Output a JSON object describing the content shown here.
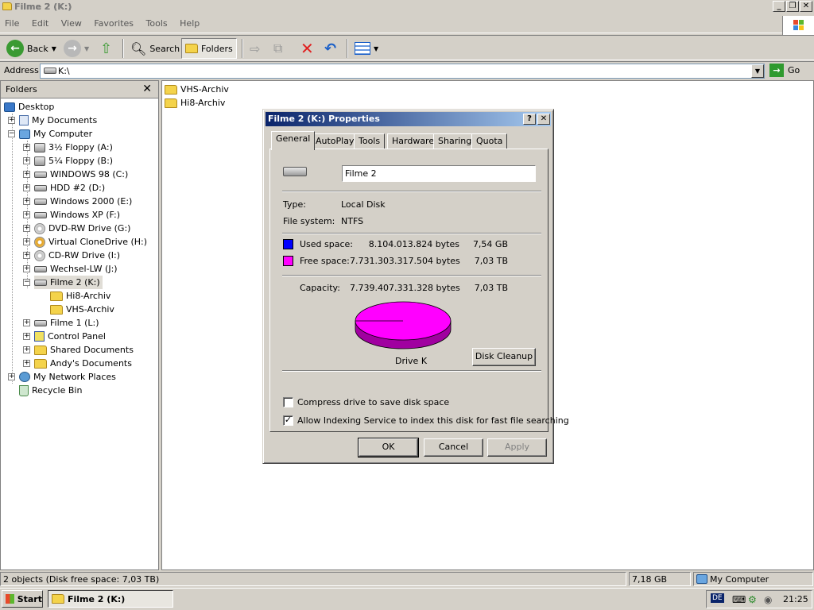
{
  "window": {
    "title": "Filme 2 (K:)"
  },
  "menu": [
    "File",
    "Edit",
    "View",
    "Favorites",
    "Tools",
    "Help"
  ],
  "toolbar": {
    "back": "Back",
    "search": "Search",
    "folders": "Folders"
  },
  "address": {
    "label": "Address",
    "value": "K:\\",
    "go": "Go"
  },
  "folders_pane": {
    "title": "Folders",
    "items": [
      "Desktop",
      "My Documents",
      "My Computer",
      "3½ Floppy (A:)",
      "5¼ Floppy (B:)",
      "WINDOWS 98 (C:)",
      "HDD #2 (D:)",
      "Windows 2000 (E:)",
      "Windows XP (F:)",
      "DVD-RW Drive (G:)",
      "Virtual CloneDrive (H:)",
      "CD-RW Drive (I:)",
      "Wechsel-LW (J:)",
      "Filme 2 (K:)",
      "Hi8-Archiv",
      "VHS-Archiv",
      "Filme 1 (L:)",
      "Control Panel",
      "Shared Documents",
      "Andy's Documents",
      "My Network Places",
      "Recycle Bin"
    ]
  },
  "files": [
    "VHS-Archiv",
    "Hi8-Archiv"
  ],
  "dialog": {
    "title": "Filme 2 (K:) Properties",
    "tabs": [
      "General",
      "AutoPlay",
      "Tools",
      "Hardware",
      "Sharing",
      "Quota"
    ],
    "name": "Filme 2",
    "type_label": "Type:",
    "type_value": "Local Disk",
    "fs_label": "File system:",
    "fs_value": "NTFS",
    "used_label": "Used space:",
    "used_bytes": "8.104.013.824 bytes",
    "used_size": "7,54 GB",
    "free_label": "Free space:",
    "free_bytes": "7.731.303.317.504 bytes",
    "free_size": "7,03 TB",
    "cap_label": "Capacity:",
    "cap_bytes": "7.739.407.331.328 bytes",
    "cap_size": "7,03 TB",
    "drive_label": "Drive K",
    "cleanup": "Disk Cleanup",
    "compress": "Compress drive to save disk space",
    "indexing": "Allow Indexing Service to index this disk for fast file searching",
    "ok": "OK",
    "cancel": "Cancel",
    "apply": "Apply",
    "colors": {
      "used": "#0000ff",
      "free": "#ff00ff"
    }
  },
  "status": {
    "objects": "2 objects (Disk free space: 7,03 TB)",
    "size": "7,18 GB",
    "location": "My Computer"
  },
  "taskbar": {
    "start": "Start",
    "task": "Filme 2 (K:)",
    "lang": "DE",
    "time": "21:25"
  }
}
